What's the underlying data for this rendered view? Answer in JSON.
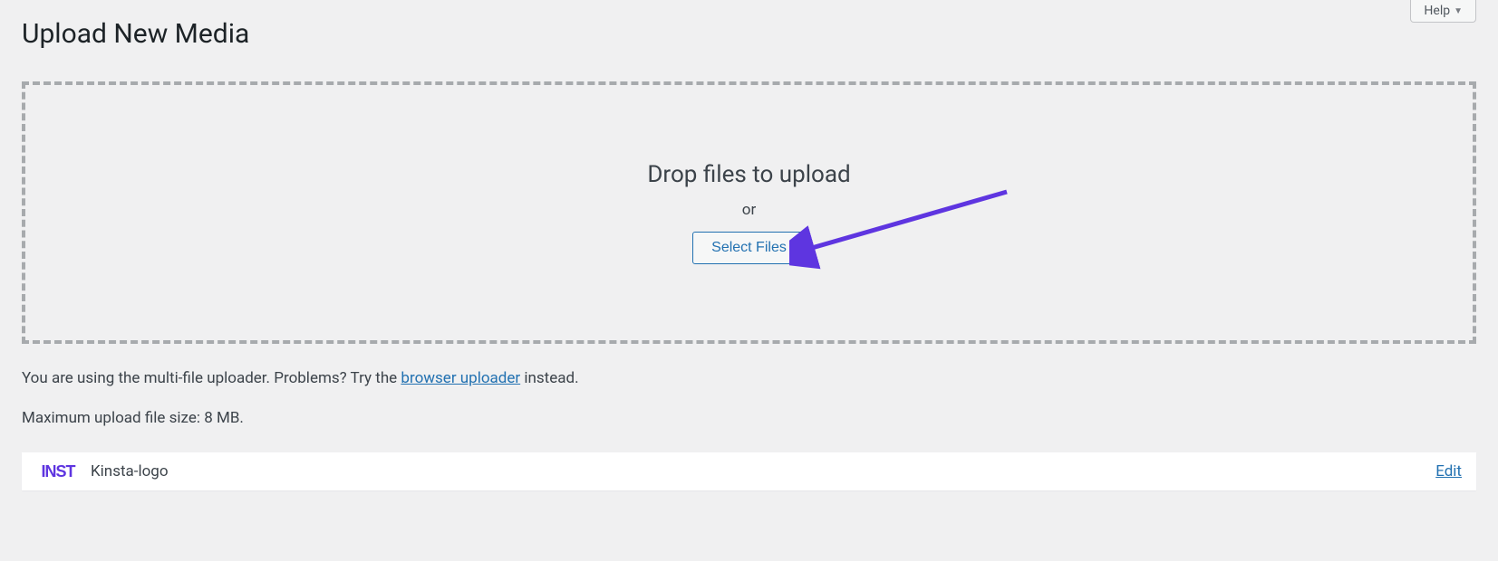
{
  "help": {
    "label": "Help"
  },
  "page": {
    "title": "Upload New Media"
  },
  "dropzone": {
    "title": "Drop files to upload",
    "or": "or",
    "select_button": "Select Files"
  },
  "info": {
    "prefix": "You are using the multi-file uploader. Problems? Try the ",
    "link": "browser uploader",
    "suffix": " instead."
  },
  "max_size": {
    "text": "Maximum upload file size: 8 MB."
  },
  "media_item": {
    "thumb_text": "INST",
    "filename": "Kinsta-logo",
    "edit": "Edit"
  }
}
